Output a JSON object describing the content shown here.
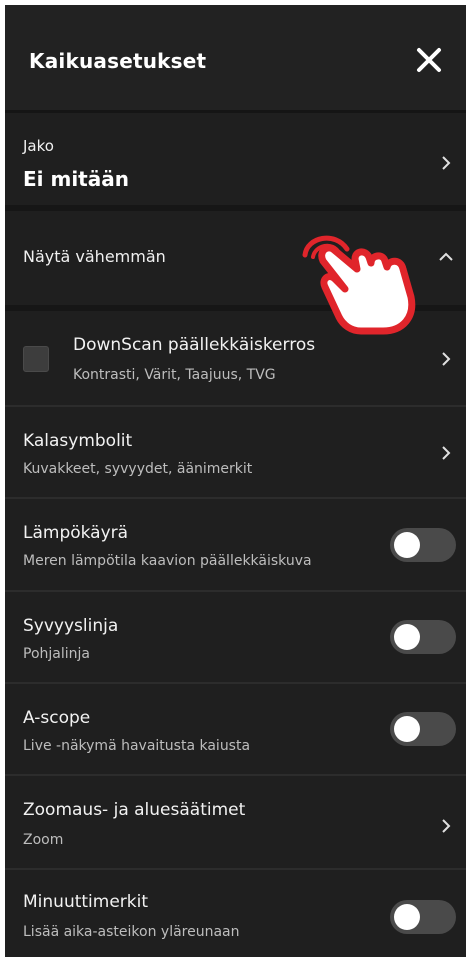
{
  "header": {
    "title": "Kaikuasetukset"
  },
  "split": {
    "label": "Jako",
    "value": "Ei mitään"
  },
  "show_less": {
    "label": "Näytä vähemmän"
  },
  "items": [
    {
      "title": "DownScan päällekkäiskerros",
      "subtitle": "Kontrasti, Värit, Taajuus, TVG",
      "control": "chevron",
      "checkbox": true
    },
    {
      "title": "Kalasymbolit",
      "subtitle": "Kuvakkeet, syvyydet, äänimerkit",
      "control": "chevron"
    },
    {
      "title": "Lämpökäyrä",
      "subtitle": "Meren lämpötila kaavion päällekkäiskuva",
      "control": "toggle",
      "on": false
    },
    {
      "title": "Syvyyslinja",
      "subtitle": "Pohjalinja",
      "control": "toggle",
      "on": false
    },
    {
      "title": "A-scope",
      "subtitle": "Live -näkymä havaitusta kaiusta",
      "control": "toggle",
      "on": false
    },
    {
      "title": "Zoomaus- ja aluesäätimet",
      "subtitle": "Zoom",
      "control": "chevron"
    },
    {
      "title": "Minuuttimerkit",
      "subtitle": "Lisää aika-asteikon yläreunaan",
      "control": "toggle",
      "on": false
    }
  ],
  "colors": {
    "panel_bg": "#1f1f1f",
    "accent_red": "#e0252b",
    "toggle_off": "#4a4a4a"
  },
  "icons": {
    "close": "close-icon",
    "chevron": "chevron-right-icon",
    "collapse": "chevron-up-icon",
    "hand": "pointing-hand-icon"
  }
}
